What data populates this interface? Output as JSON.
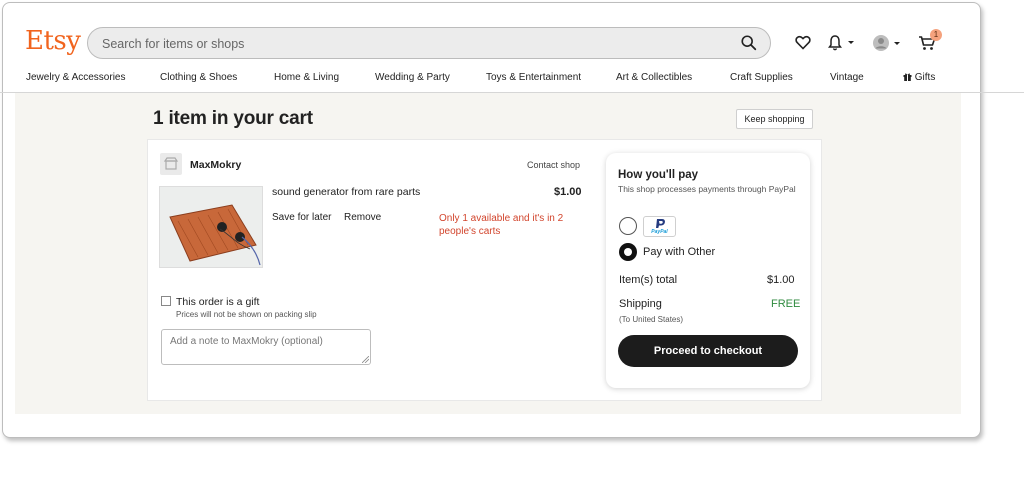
{
  "header": {
    "logo": "Etsy",
    "search_placeholder": "Search for items or shops",
    "cart_count": "1",
    "brand_color": "#F1641E"
  },
  "nav": {
    "items": [
      "Jewelry & Accessories",
      "Clothing & Shoes",
      "Home & Living",
      "Wedding & Party",
      "Toys & Entertainment",
      "Art & Collectibles",
      "Craft Supplies",
      "Vintage",
      "Gifts"
    ]
  },
  "cart": {
    "title": "1 item in your cart",
    "keep_shopping": "Keep shopping",
    "shop_name": "MaxMokry",
    "contact_shop": "Contact shop",
    "item": {
      "title": "sound generator from rare parts",
      "price": "$1.00",
      "save_for_later": "Save for later",
      "remove": "Remove",
      "availability": "Only 1 available and it's in 2 people's carts"
    },
    "gift": {
      "label": "This order is a gift",
      "note": "Prices will not be shown on packing slip"
    },
    "note_placeholder": "Add a note to MaxMokry (optional)"
  },
  "payment": {
    "title": "How you'll pay",
    "subtitle": "This shop processes payments through PayPal",
    "paypal_label": "PayPal",
    "other_label": "Pay with Other",
    "items_total_label": "Item(s) total",
    "items_total_value": "$1.00",
    "shipping_label": "Shipping",
    "shipping_value": "FREE",
    "shipping_sub": "(To United States)",
    "checkout_button": "Proceed to checkout"
  }
}
